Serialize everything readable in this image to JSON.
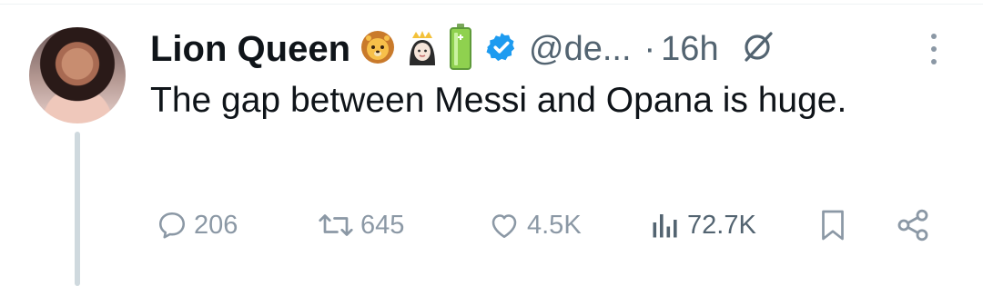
{
  "tweet": {
    "display_name": "Lion Queen",
    "handle": "@de...",
    "separator": "·",
    "time": "16h",
    "text": "The gap between Messi and Opana is huge.",
    "name_emojis": [
      "lion-face-emoji",
      "princess-emoji",
      "battery-emoji"
    ],
    "verified_color": "#1d9bf0"
  },
  "actions": {
    "replies": "206",
    "reposts": "645",
    "likes": "4.5K",
    "views": "72.7K"
  },
  "colors": {
    "text": "#0f1419",
    "muted": "#536471",
    "action_gray": "#8b98a5",
    "thread_line": "#cfd9de"
  }
}
